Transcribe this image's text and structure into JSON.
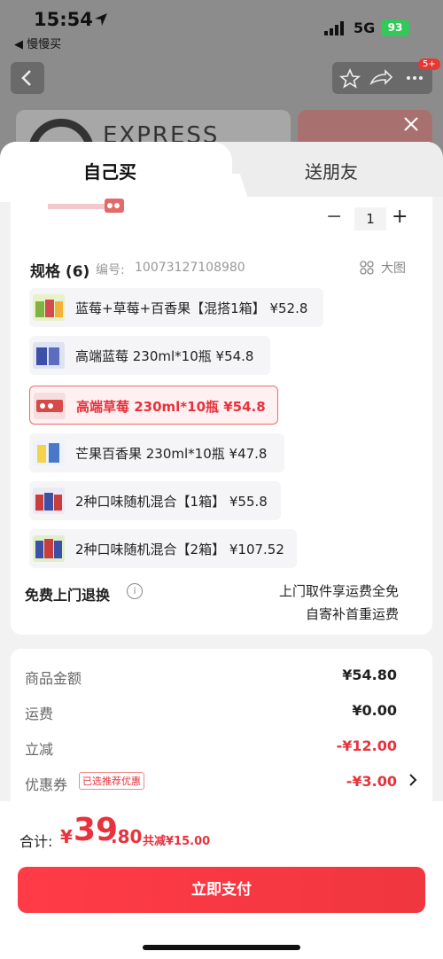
{
  "status_bar": {
    "time": "15:54",
    "back_app": "◀ 慢慢买",
    "network": "5G",
    "battery": "93"
  },
  "background": {
    "badge": "5+",
    "card_text": "EXPRESS"
  },
  "tabs": [
    {
      "label": "自己买"
    },
    {
      "label": "送朋友"
    }
  ],
  "quantity": {
    "minus": "−",
    "value": "1",
    "plus": "+"
  },
  "spec": {
    "title": "规格 (6)",
    "code_label": "编号:",
    "code": "10073127108980",
    "big_image": "大图",
    "options": [
      {
        "label": "蓝莓+草莓+百香果【混搭1箱】 ¥52.8"
      },
      {
        "label": "高端蓝莓 230ml*10瓶  ¥54.8"
      },
      {
        "label": "高端草莓 230ml*10瓶  ¥54.8",
        "selected": true
      },
      {
        "label": "芒果百香果 230ml*10瓶  ¥47.8"
      },
      {
        "label": "2种口味随机混合【1箱】 ¥55.8"
      },
      {
        "label": "2种口味随机混合【2箱】 ¥107.52"
      }
    ]
  },
  "returns": {
    "title": "免费上门退换",
    "info_icon": "i",
    "line1": "上门取件享运费全免",
    "line2": "自寄补首重运费"
  },
  "summary": {
    "rows": [
      {
        "label": "商品金额",
        "value": "¥54.80"
      },
      {
        "label": "运费",
        "value": "¥0.00"
      },
      {
        "label": "立减",
        "value": "-¥12.00"
      },
      {
        "label": "优惠券",
        "value": "-¥3.00"
      }
    ],
    "coupon_tag": "已选推荐优惠"
  },
  "footer": {
    "total_label": "合计:",
    "currency": "¥",
    "total_int": "39",
    "total_dec": ".80",
    "saved": "共减¥15.00",
    "pay_button": "立即支付"
  },
  "colors": {
    "accent": "#e8323c",
    "battery": "#34c759"
  }
}
